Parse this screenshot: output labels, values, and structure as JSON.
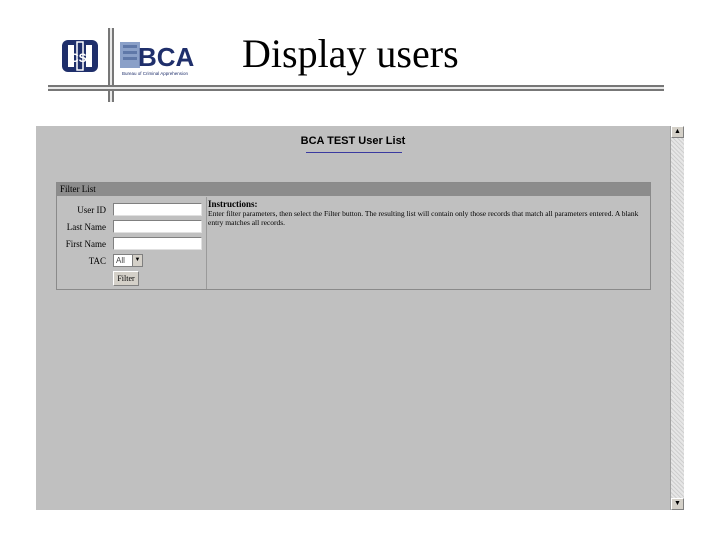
{
  "slide": {
    "title": "Display users",
    "logo_csi_text": "CSI",
    "logo_bca_text": "BCA",
    "logo_bca_subtitle": "Bureau of Criminal Apprehension"
  },
  "page": {
    "heading": "BCA TEST User List"
  },
  "filter": {
    "header": "Filter List",
    "fields": [
      {
        "label": "User ID",
        "value": ""
      },
      {
        "label": "Last Name",
        "value": ""
      },
      {
        "label": "First Name",
        "value": ""
      }
    ],
    "tac_label": "TAC",
    "tac_selected": "All",
    "filter_button": "Filter",
    "instructions_title": "Instructions:",
    "instructions_text": "Enter filter parameters, then select the Filter button. The resulting list will contain only those records that match all parameters entered. A blank entry matches all records."
  },
  "colors": {
    "page_background": "#c0c0c0",
    "panel_header": "#8c8c8c",
    "heading_rule": "#3a3aa0"
  }
}
